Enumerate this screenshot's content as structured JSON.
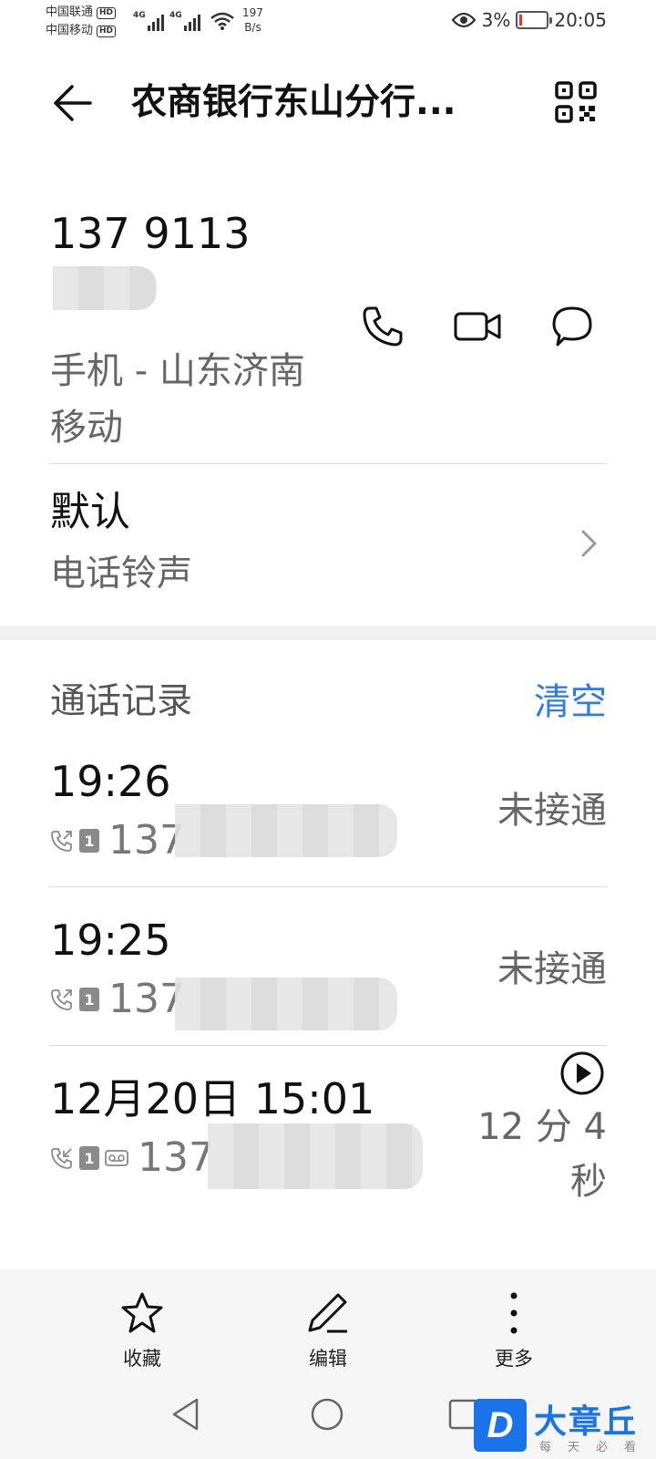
{
  "status_bar": {
    "carrier_1": "中国联通",
    "carrier_2": "中国移动",
    "hd_badge": "HD",
    "network_type": "4G",
    "net_speed_value": "197",
    "net_speed_unit": "B/s",
    "battery_percent": "3%",
    "time": "20:05"
  },
  "header": {
    "title": "农商银行东山分行..."
  },
  "contact": {
    "phone_number": "137 9113",
    "number_type": "手机 - 山东济南 移动"
  },
  "ringtone": {
    "value": "默认",
    "label": "电话铃声"
  },
  "call_log": {
    "title": "通话记录",
    "clear_label": "清空",
    "entries": [
      {
        "time": "19:26",
        "sim": "1",
        "number_prefix": "137",
        "status": "未接通"
      },
      {
        "time": "19:25",
        "sim": "1",
        "number_prefix": "137",
        "status": "未接通"
      },
      {
        "time": "12月20日 15:01",
        "sim": "1",
        "number_prefix": "137",
        "status": "12 分 4 秒"
      }
    ]
  },
  "bottom_actions": {
    "favorite": "收藏",
    "edit": "编辑",
    "more": "更多"
  },
  "watermark": {
    "logo_letter": "D",
    "name": "大章丘",
    "slogan": "每天必看"
  },
  "colors": {
    "accent": "#2e7de5",
    "battery_low": "#e53935"
  }
}
